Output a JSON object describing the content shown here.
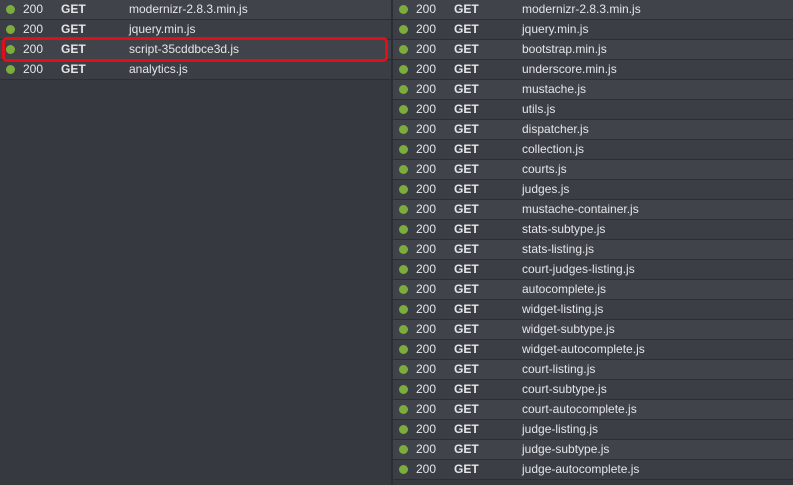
{
  "colors": {
    "success_dot": "#7cad3c",
    "highlight_border": "#e0101a"
  },
  "icons": {
    "status_dot": "status-dot-icon"
  },
  "left_requests": [
    {
      "status": "200",
      "method": "GET",
      "file": "modernizr-2.8.3.min.js"
    },
    {
      "status": "200",
      "method": "GET",
      "file": "jquery.min.js"
    },
    {
      "status": "200",
      "method": "GET",
      "file": "script-35cddbce3d.js"
    },
    {
      "status": "200",
      "method": "GET",
      "file": "analytics.js"
    }
  ],
  "right_requests": [
    {
      "status": "200",
      "method": "GET",
      "file": "modernizr-2.8.3.min.js"
    },
    {
      "status": "200",
      "method": "GET",
      "file": "jquery.min.js"
    },
    {
      "status": "200",
      "method": "GET",
      "file": "bootstrap.min.js"
    },
    {
      "status": "200",
      "method": "GET",
      "file": "underscore.min.js"
    },
    {
      "status": "200",
      "method": "GET",
      "file": "mustache.js"
    },
    {
      "status": "200",
      "method": "GET",
      "file": "utils.js"
    },
    {
      "status": "200",
      "method": "GET",
      "file": "dispatcher.js"
    },
    {
      "status": "200",
      "method": "GET",
      "file": "collection.js"
    },
    {
      "status": "200",
      "method": "GET",
      "file": "courts.js"
    },
    {
      "status": "200",
      "method": "GET",
      "file": "judges.js"
    },
    {
      "status": "200",
      "method": "GET",
      "file": "mustache-container.js"
    },
    {
      "status": "200",
      "method": "GET",
      "file": "stats-subtype.js"
    },
    {
      "status": "200",
      "method": "GET",
      "file": "stats-listing.js"
    },
    {
      "status": "200",
      "method": "GET",
      "file": "court-judges-listing.js"
    },
    {
      "status": "200",
      "method": "GET",
      "file": "autocomplete.js"
    },
    {
      "status": "200",
      "method": "GET",
      "file": "widget-listing.js"
    },
    {
      "status": "200",
      "method": "GET",
      "file": "widget-subtype.js"
    },
    {
      "status": "200",
      "method": "GET",
      "file": "widget-autocomplete.js"
    },
    {
      "status": "200",
      "method": "GET",
      "file": "court-listing.js"
    },
    {
      "status": "200",
      "method": "GET",
      "file": "court-subtype.js"
    },
    {
      "status": "200",
      "method": "GET",
      "file": "court-autocomplete.js"
    },
    {
      "status": "200",
      "method": "GET",
      "file": "judge-listing.js"
    },
    {
      "status": "200",
      "method": "GET",
      "file": "judge-subtype.js"
    },
    {
      "status": "200",
      "method": "GET",
      "file": "judge-autocomplete.js"
    }
  ]
}
